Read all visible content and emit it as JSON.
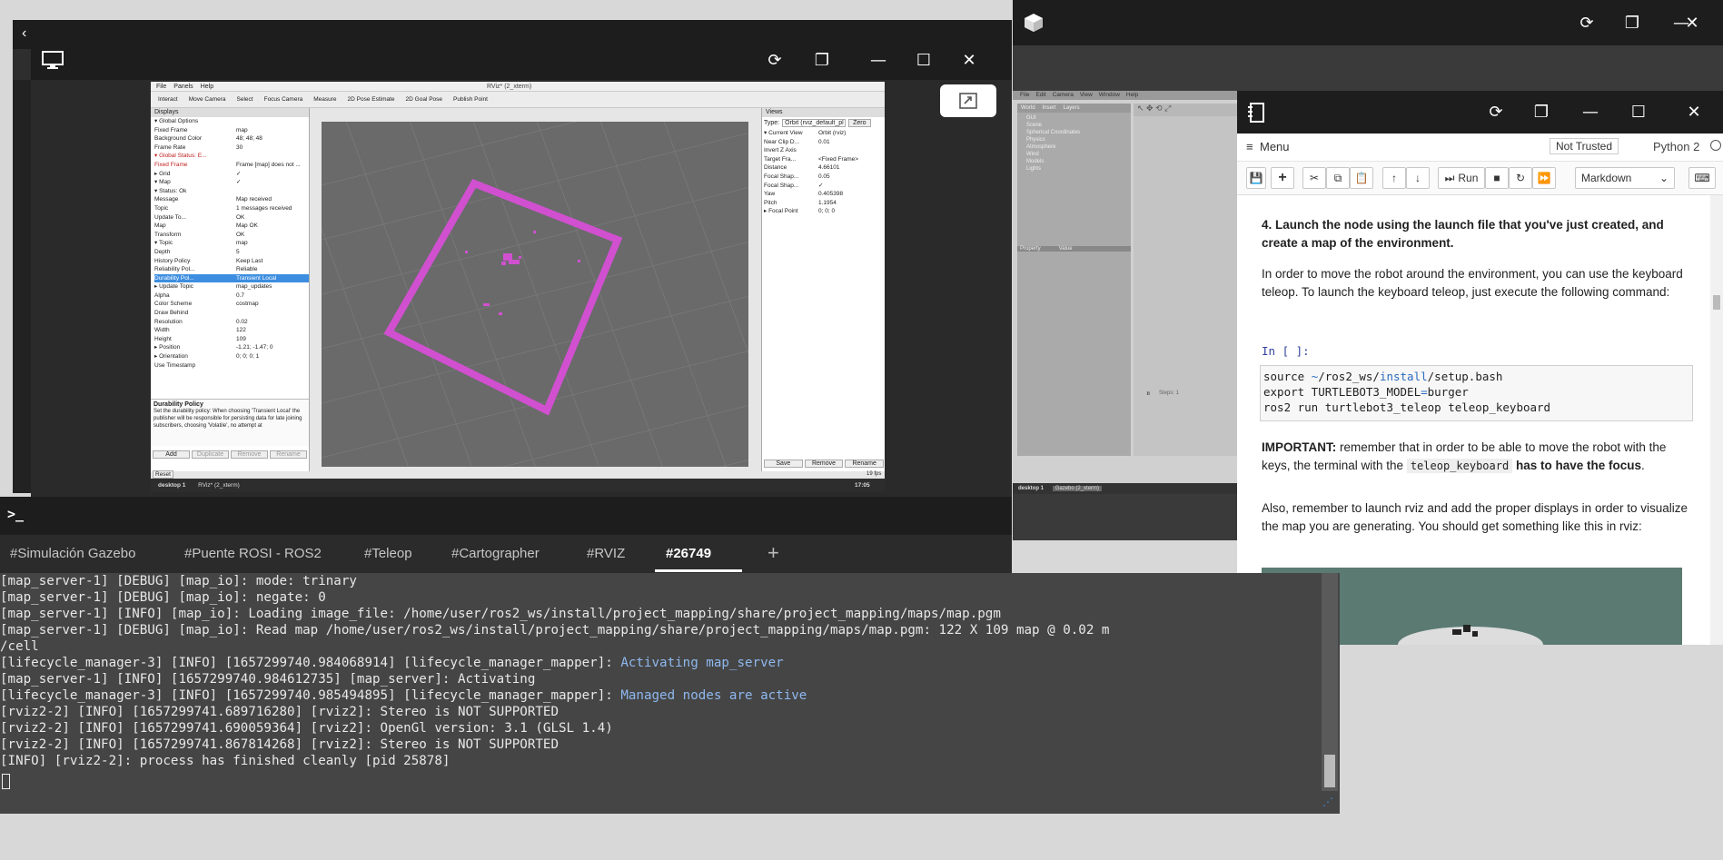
{
  "desktop": {
    "viewer_title_icon": "monitor-icon",
    "rviz": {
      "title": "RViz* (2_xterm)",
      "menu": [
        "File",
        "Panels",
        "Help"
      ],
      "toolbar": [
        "Interact",
        "Move Camera",
        "Select",
        "Focus Camera",
        "Measure",
        "2D Pose Estimate",
        "2D Goal Pose",
        "Publish Point"
      ],
      "displays_header": "Displays",
      "views_header": "Views",
      "tree": [
        {
          "k": "▾ Global Options",
          "v": ""
        },
        {
          "k": "   Fixed Frame",
          "v": "map"
        },
        {
          "k": "   Background Color",
          "v": "48; 48; 48"
        },
        {
          "k": "   Frame Rate",
          "v": "30"
        },
        {
          "k": "▾ Global Status: E...",
          "v": ""
        },
        {
          "k": "   Fixed Frame",
          "v": "Frame [map] does not ..."
        },
        {
          "k": "▸ Grid",
          "v": "✓"
        },
        {
          "k": "▾ Map",
          "v": "✓"
        },
        {
          "k": "  ▾ Status: Ok",
          "v": ""
        },
        {
          "k": "     Message",
          "v": "Map received"
        },
        {
          "k": "     Topic",
          "v": "1 messages received"
        },
        {
          "k": "     Update To...",
          "v": "OK"
        },
        {
          "k": "     Map",
          "v": "Map OK"
        },
        {
          "k": "     Transform",
          "v": "OK"
        },
        {
          "k": "  ▾ Topic",
          "v": "map"
        },
        {
          "k": "     Depth",
          "v": "5"
        },
        {
          "k": "     History Policy",
          "v": "Keep Last"
        },
        {
          "k": "     Reliability Pol...",
          "v": "Reliable"
        },
        {
          "k": "     Durability Pol...",
          "v": "Transient Local"
        },
        {
          "k": "  ▸ Update Topic",
          "v": "map_updates"
        },
        {
          "k": "    Alpha",
          "v": "0.7"
        },
        {
          "k": "    Color Scheme",
          "v": "costmap"
        },
        {
          "k": "    Draw Behind",
          "v": ""
        },
        {
          "k": "    Resolution",
          "v": "0.02"
        },
        {
          "k": "    Width",
          "v": "122"
        },
        {
          "k": "    Height",
          "v": "109"
        },
        {
          "k": "  ▸ Position",
          "v": "-1.21; -1.47; 0"
        },
        {
          "k": "  ▸ Orientation",
          "v": "0; 0; 0; 1"
        },
        {
          "k": "    Use Timestamp",
          "v": ""
        }
      ],
      "selected_row": 18,
      "desc_title": "Durability Policy",
      "desc_text": "Set the durability policy: When choosing 'Transient Local' the publisher will be responsible for persisting data for late joining subscribers, choosing 'Volatile', no attempt at",
      "left_buttons": [
        "Add",
        "Duplicate",
        "Remove",
        "Rename"
      ],
      "view_type_label": "Type:",
      "view_type": "Orbit (rviz_default_pl",
      "zero_label": "Zero",
      "view_props": [
        {
          "k": "▾ Current View",
          "v": "Orbit (rviz)"
        },
        {
          "k": "   Near Clip D...",
          "v": "0.01"
        },
        {
          "k": "   Invert Z Axis",
          "v": ""
        },
        {
          "k": "   Target Fra...",
          "v": "<Fixed Frame>"
        },
        {
          "k": "   Distance",
          "v": "4.66101"
        },
        {
          "k": "   Focal Shap...",
          "v": "0.05"
        },
        {
          "k": "   Focal Shap...",
          "v": "✓"
        },
        {
          "k": "   Yaw",
          "v": "0.405398"
        },
        {
          "k": "   Pitch",
          "v": "1.1954"
        },
        {
          "k": " ▸ Focal Point",
          "v": "0; 0; 0"
        }
      ],
      "right_buttons": [
        "Save",
        "Remove",
        "Rename"
      ],
      "reset": "Reset",
      "fps": "19 fps",
      "taskbar": [
        "desktop 1",
        "RViz* (2_xterm)"
      ],
      "clock": "17:05"
    }
  },
  "gazebo": {
    "tabs": [
      "World",
      "Insert",
      "Layers"
    ],
    "tree": [
      "GUI",
      "Scene",
      "Spherical Coordinates",
      "Physics",
      "Atmosphere",
      "Wind",
      "Models",
      "Lights"
    ],
    "prop_headers": [
      "Property",
      "Value"
    ],
    "menu": [
      "File",
      "Edit",
      "Camera",
      "View",
      "Window",
      "Help"
    ],
    "taskbar": [
      "desktop 1",
      "Gazebo (2_xterm)"
    ],
    "steps": "Steps: 1"
  },
  "notebook": {
    "menu_label": "Menu",
    "trust_badge": "Not Trusted",
    "kernel": "Python 2",
    "cell_type": "Markdown",
    "run_label": "Run",
    "heading": "4. Launch the node using the launch file that you've just created, and create a map of the environment.",
    "para1": "In order to move the robot around the environment, you can use the keyboard teleop. To launch the keyboard teleop, just execute the following command:",
    "prompt": "In [ ]:",
    "code": [
      {
        "pre": "source ",
        "hl": "~",
        "mid": "/ros2_ws/",
        "hl2": "install",
        "post": "/setup.bash"
      },
      {
        "pre": "export TURTLEBOT3_MODEL",
        "hl": "=",
        "mid": "burger",
        "hl2": "",
        "post": ""
      },
      {
        "pre": "ros2 run turtlebot3_teleop teleop_keyboard",
        "hl": "",
        "mid": "",
        "hl2": "",
        "post": ""
      }
    ],
    "important_label": "IMPORTANT:",
    "important_text": " remember that in order to be able to move the robot with the keys, the terminal with the ",
    "important_code": "teleop_keyboard",
    "important_end": "has to have the focus",
    "important_dot": ".",
    "para2": "Also, remember to launch rviz and add the proper displays in order to visualize the map you are generating. You should get something like this in rviz:"
  },
  "terminal": {
    "tabs": [
      "#Simulación Gazebo",
      "#Puente ROSI - ROS2",
      "#Teleop",
      "#Cartographer",
      "#RVIZ",
      "#26749"
    ],
    "active_tab": 5,
    "add_tab": "+",
    "lines": [
      {
        "t": "[map_server-1] [DEBUG] [map_io]: mode: trinary",
        "h": ""
      },
      {
        "t": "[map_server-1] [DEBUG] [map_io]: negate: 0",
        "h": ""
      },
      {
        "t": "[map_server-1] [INFO] [map_io]: Loading image_file: /home/user/ros2_ws/install/project_mapping/share/project_mapping/maps/map.pgm",
        "h": ""
      },
      {
        "t": "[map_server-1] [DEBUG] [map_io]: Read map /home/user/ros2_ws/install/project_mapping/share/project_mapping/maps/map.pgm: 122 X 109 map @ 0.02 m",
        "h": ""
      },
      {
        "t": "/cell",
        "h": ""
      },
      {
        "t": "[lifecycle_manager-3] [INFO] [1657299740.984068914] [lifecycle_manager_mapper]: ",
        "h": "Activating map_server"
      },
      {
        "t": "[map_server-1] [INFO] [1657299740.984612735] [map_server]: Activating",
        "h": ""
      },
      {
        "t": "[lifecycle_manager-3] [INFO] [1657299740.985494895] [lifecycle_manager_mapper]: ",
        "h": "Managed nodes are active"
      },
      {
        "t": "[rviz2-2] [INFO] [1657299741.689716280] [rviz2]: Stereo is NOT SUPPORTED",
        "h": ""
      },
      {
        "t": "[rviz2-2] [INFO] [1657299741.690059364] [rviz2]: OpenGl version: 3.1 (GLSL 1.4)",
        "h": ""
      },
      {
        "t": "[rviz2-2] [INFO] [1657299741.867814268] [rviz2]: Stereo is NOT SUPPORTED",
        "h": ""
      },
      {
        "t": "[INFO] [rviz2-2]: process has finished cleanly [pid 25878]",
        "h": ""
      }
    ]
  },
  "colors": {
    "accent": "#8fb8ee",
    "map": "#d050d0",
    "titlebar": "#1d1d1d"
  }
}
